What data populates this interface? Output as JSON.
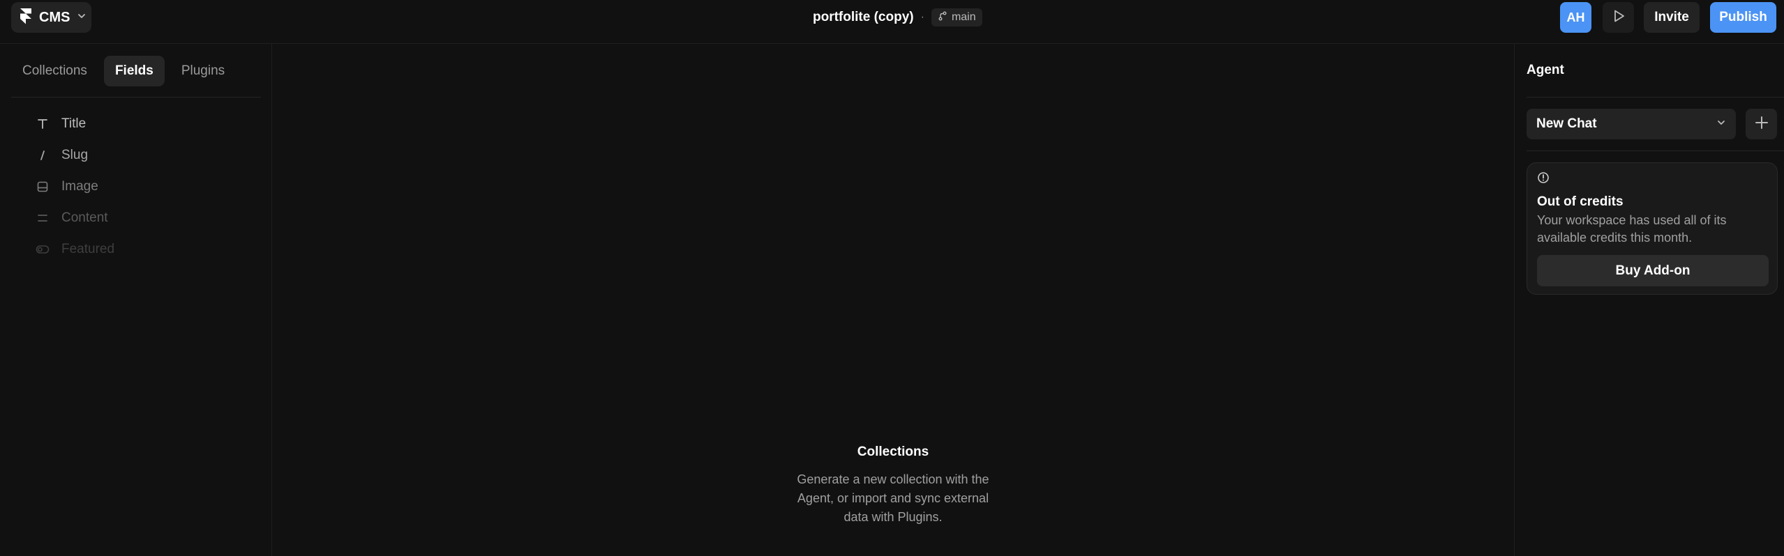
{
  "colors": {
    "background": "#111111",
    "accent": "#4b93f5",
    "surface": "#232323"
  },
  "topbar": {
    "app_label": "CMS",
    "project_name": "portfolite (copy)",
    "separator": "·",
    "branch": "main",
    "avatar_initials": "AH",
    "invite_label": "Invite",
    "publish_label": "Publish"
  },
  "left_panel": {
    "tabs": [
      {
        "label": "Collections",
        "active": false
      },
      {
        "label": "Fields",
        "active": true
      },
      {
        "label": "Plugins",
        "active": false
      }
    ],
    "fields": [
      {
        "label": "Title",
        "icon": "text-icon",
        "color": "#bdbdbd"
      },
      {
        "label": "Slug",
        "icon": "slash-icon",
        "color": "#a8a8a8"
      },
      {
        "label": "Image",
        "icon": "image-icon",
        "color": "#7d7d7d"
      },
      {
        "label": "Content",
        "icon": "lines-icon",
        "color": "#5a5a5a"
      },
      {
        "label": "Featured",
        "icon": "toggle-icon",
        "color": "#3e3e3e"
      }
    ]
  },
  "center": {
    "title": "Collections",
    "description": "Generate a new collection with the Agent, or import and sync external data with Plugins."
  },
  "agent": {
    "title": "Agent",
    "chat_select": "New Chat",
    "card": {
      "title": "Out of credits",
      "description": "Your workspace has used all of its available credits this month.",
      "button": "Buy Add-on"
    }
  }
}
